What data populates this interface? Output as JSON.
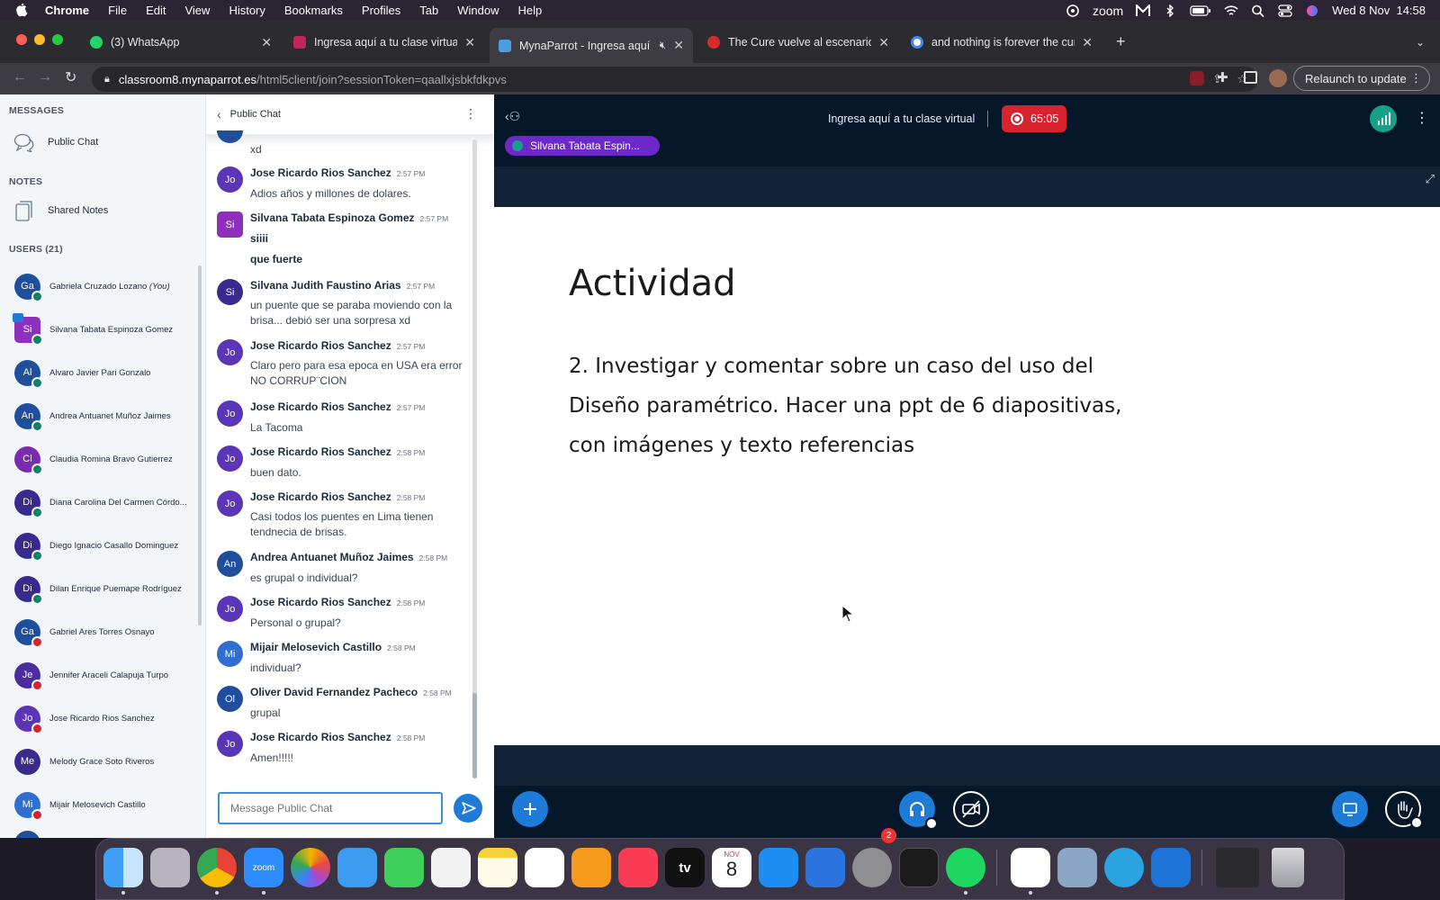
{
  "menubar": {
    "app": "Chrome",
    "items": [
      "File",
      "Edit",
      "View",
      "History",
      "Bookmarks",
      "Profiles",
      "Tab",
      "Window",
      "Help"
    ],
    "zoom": "zoom",
    "clock": "Wed 8 Nov  14:58"
  },
  "tabs": [
    {
      "title": "(3) WhatsApp",
      "color": "#25d366"
    },
    {
      "title": "Ingresa aquí a tu clase virtual",
      "color": "#c0265a"
    },
    {
      "title": "MynaParrot - Ingresa aquí",
      "color": "#4a9fe0"
    },
    {
      "title": "The Cure vuelve al escenario",
      "color": "#d62b2b"
    },
    {
      "title": "and nothing is forever the cure",
      "color": "#4285f4"
    }
  ],
  "address": {
    "domain": "classroom8.mynaparrot.es",
    "path": "/html5client/join?sessionToken=qaallxjsbkfdkpvs"
  },
  "relaunch_label": "Relaunch to update",
  "sidebar": {
    "messages_heading": "MESSAGES",
    "public_chat": "Public Chat",
    "notes_heading": "NOTES",
    "shared_notes": "Shared Notes",
    "users_heading": "USERS (21)",
    "you_tag": "(You)",
    "users": [
      {
        "initials": "Ga",
        "name": "Gabriela Cruzado Lozano",
        "color": "#1f4e9c",
        "status": "#0f7e68"
      },
      {
        "initials": "Si",
        "name": "Silvana Tabata Espinoza Gomez",
        "color": "#8e2fbf",
        "status": "#0f7e68"
      },
      {
        "initials": "Al",
        "name": "Alvaro Javier Pari Gonzalo",
        "color": "#1f4e9c",
        "status": "#0f7e68"
      },
      {
        "initials": "An",
        "name": "Andrea Antuanet Muñoz Jaimes",
        "color": "#1f4e9c",
        "status": "#0f7e68"
      },
      {
        "initials": "Cl",
        "name": "Claudia Romina Bravo Gutierrez",
        "color": "#7b2bb0",
        "status": "#0f7e68"
      },
      {
        "initials": "Di",
        "name": "Diana Carolina Del Carmen Córdo...",
        "color": "#3a2a8e",
        "status": "#0f7e68"
      },
      {
        "initials": "Di",
        "name": "Diego Ignacio Casallo Dominguez",
        "color": "#3a2a8e",
        "status": "#0f7e68"
      },
      {
        "initials": "Di",
        "name": "Dilan Enrique Puemape Rodríguez",
        "color": "#3a2a8e",
        "status": "#0f7e68"
      },
      {
        "initials": "Ga",
        "name": "Gabriel Ares Torres Osnayo",
        "color": "#1f4e9c",
        "status": "#d8222e"
      },
      {
        "initials": "Je",
        "name": "Jennifer Araceli Calapuja Turpo",
        "color": "#4a2c9e",
        "status": "#d8222e"
      },
      {
        "initials": "Jo",
        "name": "Jose Ricardo Rios Sanchez",
        "color": "#5a35b8",
        "status": "#d8222e"
      },
      {
        "initials": "Me",
        "name": "Melody Grace Soto Riveros",
        "color": "#3a2a8e",
        "status": ""
      },
      {
        "initials": "Mi",
        "name": "Mijair Melosevich Castillo",
        "color": "#2f6fd0",
        "status": "#d8222e"
      }
    ]
  },
  "chat": {
    "title": "Public Chat",
    "top_fragment": "xd",
    "messages": [
      {
        "initials": "Jo",
        "author": "Jose Ricardo Rios Sanchez",
        "time": "2:57 PM",
        "color": "#5a35b8",
        "lines": [
          "Adios años y millones de dolares."
        ]
      },
      {
        "initials": "Si",
        "author": "Silvana Tabata Espinoza Gomez",
        "time": "2:57 PM",
        "color": "#8e2fbf",
        "square": true,
        "lines": [
          "siiii",
          "que fuerte"
        ],
        "bold": true
      },
      {
        "initials": "Si",
        "author": "Silvana Judith Faustino Arias",
        "time": "2:57 PM",
        "color": "#3a2a8e",
        "lines": [
          "un puente que se paraba moviendo con la brisa... debió ser una sorpresa xd"
        ]
      },
      {
        "initials": "Jo",
        "author": "Jose Ricardo Rios Sanchez",
        "time": "2:57 PM",
        "color": "#5a35b8",
        "lines": [
          "Claro pero para esa epoca en USA era error NO CORRUP¨CION"
        ]
      },
      {
        "initials": "Jo",
        "author": "Jose Ricardo Rios Sanchez",
        "time": "2:57 PM",
        "color": "#5a35b8",
        "lines": [
          "La Tacoma"
        ]
      },
      {
        "initials": "Jo",
        "author": "Jose Ricardo Rios Sanchez",
        "time": "2:58 PM",
        "color": "#5a35b8",
        "lines": [
          "buen dato."
        ]
      },
      {
        "initials": "Jo",
        "author": "Jose Ricardo Rios Sanchez",
        "time": "2:58 PM",
        "color": "#5a35b8",
        "lines": [
          "Casi todos los puentes en Lima tienen tendnecia de brisas."
        ]
      },
      {
        "initials": "An",
        "author": "Andrea Antuanet Muñoz Jaimes",
        "time": "2:58 PM",
        "color": "#1f4e9c",
        "lines": [
          "es grupal o individual?"
        ]
      },
      {
        "initials": "Jo",
        "author": "Jose Ricardo Rios Sanchez",
        "time": "2:58 PM",
        "color": "#5a35b8",
        "lines": [
          "Personal o grupal?"
        ]
      },
      {
        "initials": "Mi",
        "author": "Mijair Melosevich Castillo",
        "time": "2:58 PM",
        "color": "#2f6fd0",
        "lines": [
          "individual?"
        ]
      },
      {
        "initials": "Ol",
        "author": "Oliver David Fernandez Pacheco",
        "time": "2:58 PM",
        "color": "#1f4e9c",
        "lines": [
          "grupal"
        ]
      },
      {
        "initials": "Jo",
        "author": "Jose Ricardo Rios Sanchez",
        "time": "2:58 PM",
        "color": "#5a35b8",
        "lines": [
          "Amen!!!!!"
        ]
      }
    ],
    "placeholder": "Message Public Chat"
  },
  "meeting": {
    "title": "Ingresa aquí a tu clase virtual",
    "timer": "65:05",
    "talker": "Silvana Tabata Espin...",
    "slide_title": "Actividad",
    "slide_body": "2. Investigar y comentar sobre un caso del uso del Diseño paramétrico. Hacer una ppt de 6 diapositivas, con imágenes y texto referencias"
  },
  "dock": {
    "calendar_month": "NOV",
    "calendar_day": "8",
    "settings_badge": "2",
    "zoom_label": "zoom",
    "tv_label": "tv"
  }
}
